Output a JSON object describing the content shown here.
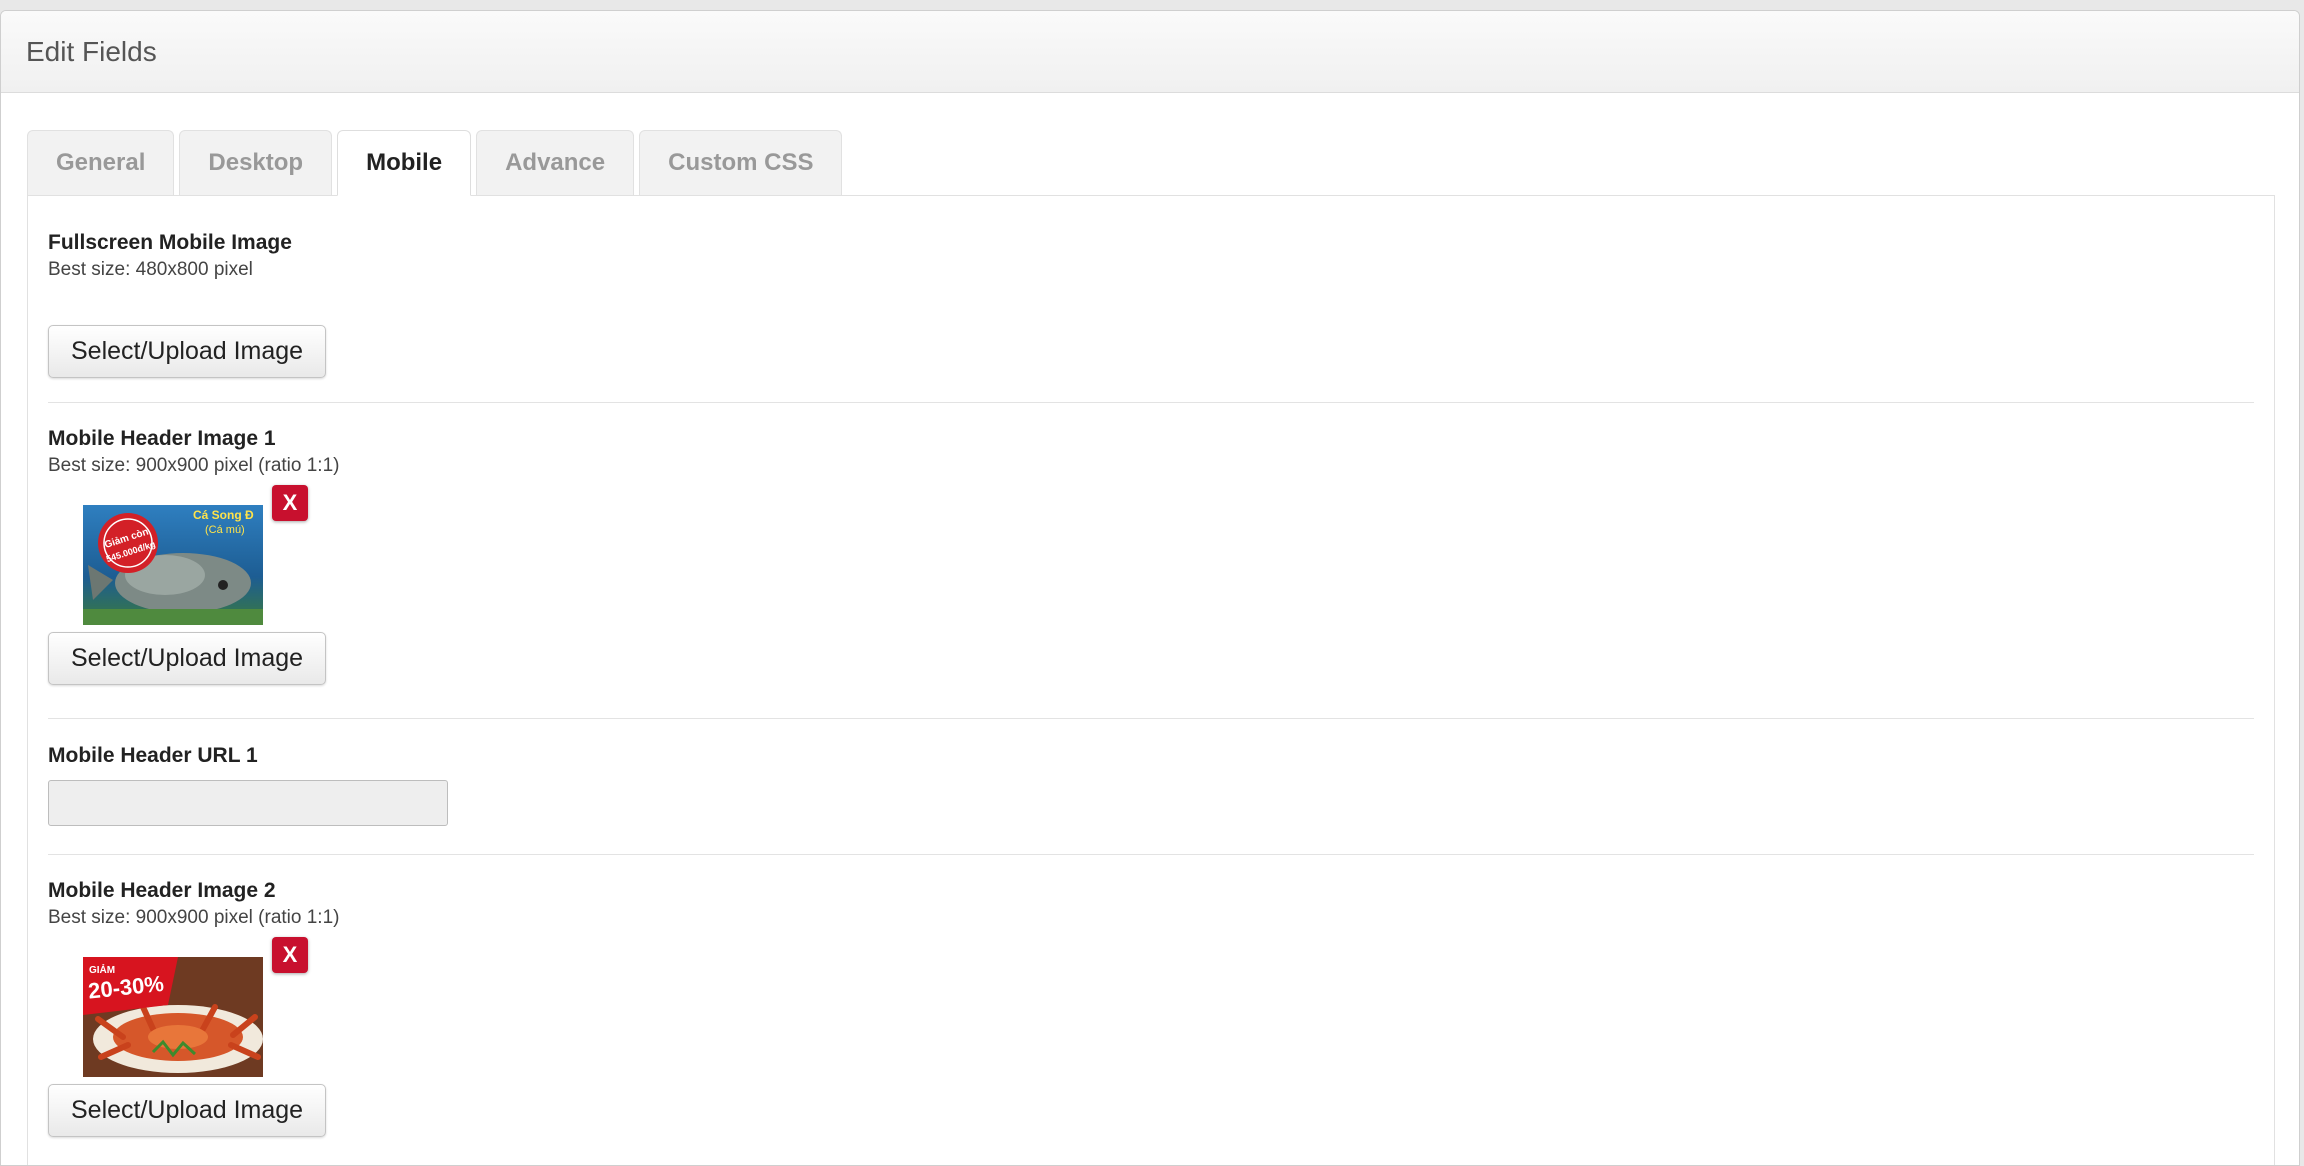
{
  "window": {
    "title": "Edit Fields"
  },
  "tabs": [
    {
      "label": "General",
      "active": false
    },
    {
      "label": "Desktop",
      "active": false
    },
    {
      "label": "Mobile",
      "active": true
    },
    {
      "label": "Advance",
      "active": false
    },
    {
      "label": "Custom CSS",
      "active": false
    }
  ],
  "fields": {
    "fullscreen": {
      "label": "Fullscreen Mobile Image",
      "hint": "Best size: 480x800 pixel",
      "button": "Select/Upload Image"
    },
    "header1": {
      "label": "Mobile Header Image 1",
      "hint": "Best size: 900x900 pixel (ratio 1:1)",
      "button": "Select/Upload Image",
      "remove": "X",
      "thumb": {
        "badge_lines": [
          "Giảm còn",
          "545.000đ/kg"
        ],
        "caption_lines": [
          "Cá Song Đ",
          "(Cá mú)"
        ]
      }
    },
    "url1": {
      "label": "Mobile Header URL 1",
      "value": ""
    },
    "header2": {
      "label": "Mobile Header Image 2",
      "hint": "Best size: 900x900 pixel (ratio 1:1)",
      "button": "Select/Upload Image",
      "remove": "X",
      "thumb": {
        "promo_small": "GIẢM",
        "promo_big": "20-30%"
      }
    }
  },
  "colors": {
    "remove_red": "#c8102e",
    "active_tab_text": "#222222",
    "inactive_tab_text": "#999999"
  }
}
